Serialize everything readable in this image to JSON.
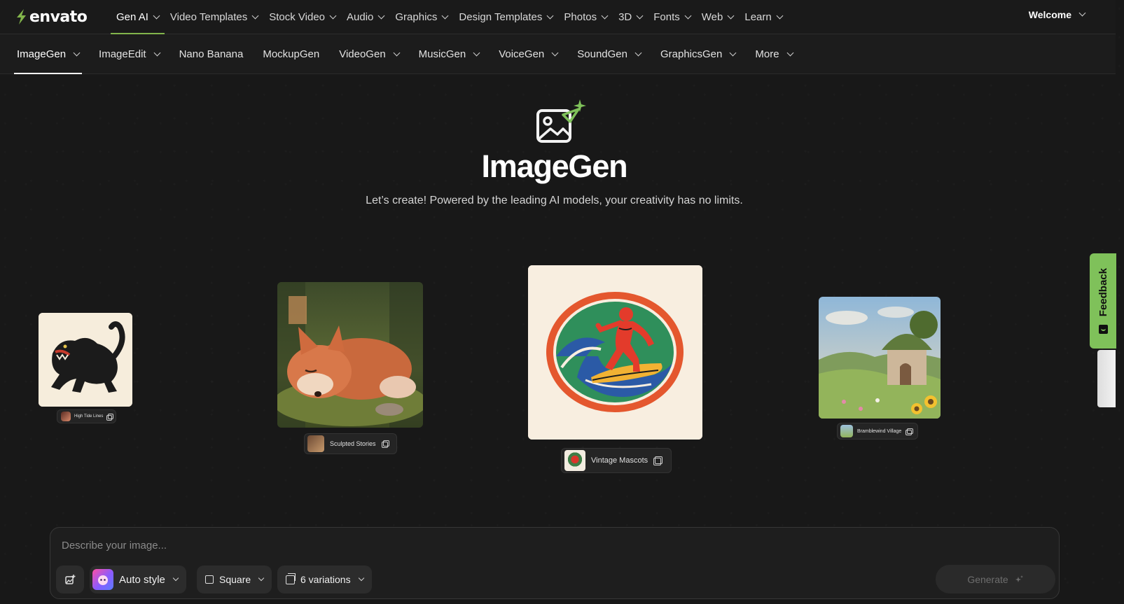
{
  "brand": {
    "name": "envato",
    "accent": "#82b54b"
  },
  "topnav": {
    "items": [
      {
        "label": "Gen AI",
        "active": true
      },
      {
        "label": "Video Templates"
      },
      {
        "label": "Stock Video"
      },
      {
        "label": "Audio"
      },
      {
        "label": "Graphics"
      },
      {
        "label": "Design Templates"
      },
      {
        "label": "Photos"
      },
      {
        "label": "3D"
      },
      {
        "label": "Fonts"
      },
      {
        "label": "Web"
      },
      {
        "label": "Learn"
      }
    ],
    "welcome": "Welcome"
  },
  "subnav": {
    "items": [
      {
        "label": "ImageGen",
        "active": true,
        "dropdown": true
      },
      {
        "label": "ImageEdit",
        "dropdown": true
      },
      {
        "label": "Nano Banana",
        "dropdown": false
      },
      {
        "label": "MockupGen",
        "dropdown": false
      },
      {
        "label": "VideoGen",
        "dropdown": true
      },
      {
        "label": "MusicGen",
        "dropdown": true
      },
      {
        "label": "VoiceGen",
        "dropdown": true
      },
      {
        "label": "SoundGen",
        "dropdown": true
      },
      {
        "label": "GraphicsGen",
        "dropdown": true
      },
      {
        "label": "More",
        "dropdown": true
      }
    ]
  },
  "hero": {
    "icon": "image-sparkle-icon",
    "title": "ImageGen",
    "subtitle": "Let’s create! Powered by the leading AI models, your creativity has no limits."
  },
  "gallery": {
    "cards": [
      {
        "label": "High Tide Lines"
      },
      {
        "label": "Sculpted Stories"
      },
      {
        "label": "Vintage Mascots"
      },
      {
        "label": "Bramblewind Village"
      }
    ]
  },
  "feedback": {
    "label": "Feedback",
    "color": "#7fc15a"
  },
  "prompt": {
    "placeholder": "Describe your image...",
    "style_label": "Auto style",
    "ratio_label": "Square",
    "variations_label": "6 variations",
    "generate_label": "Generate"
  }
}
